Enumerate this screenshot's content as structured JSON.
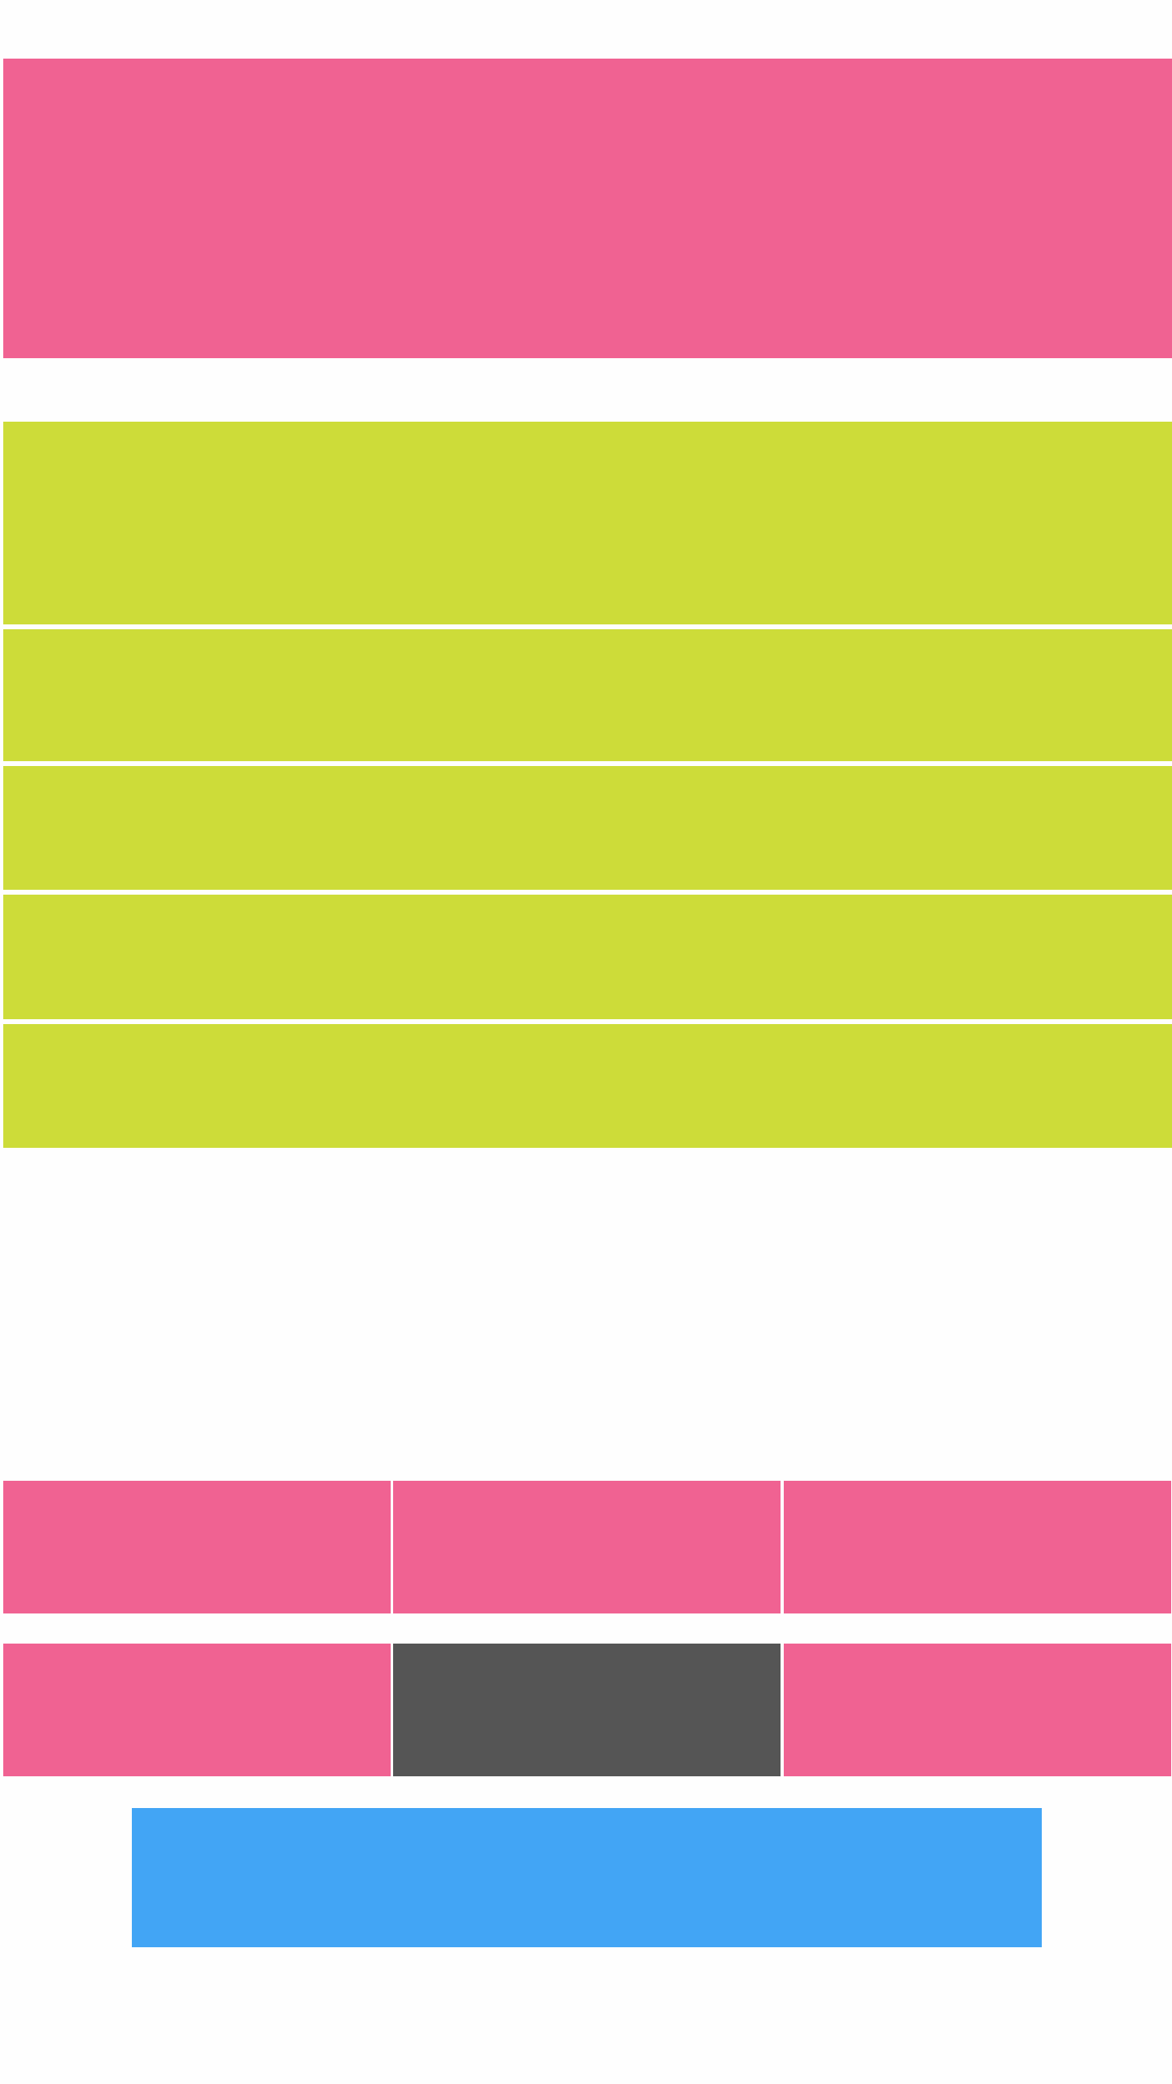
{
  "colors": {
    "background": "#fefefe",
    "hero": "#f06292",
    "list_item": "#cddc39",
    "tile": "#f06292",
    "tile_selected": "#555555",
    "cta": "#42a5f5"
  },
  "hero": {
    "label": ""
  },
  "list": {
    "items": [
      {
        "label": ""
      },
      {
        "label": ""
      },
      {
        "label": ""
      },
      {
        "label": ""
      },
      {
        "label": ""
      }
    ]
  },
  "grid": {
    "rows": [
      [
        {
          "label": ""
        },
        {
          "label": ""
        },
        {
          "label": ""
        }
      ],
      [
        {
          "label": ""
        },
        {
          "label": "",
          "selected": true
        },
        {
          "label": ""
        }
      ]
    ]
  },
  "cta": {
    "label": ""
  }
}
